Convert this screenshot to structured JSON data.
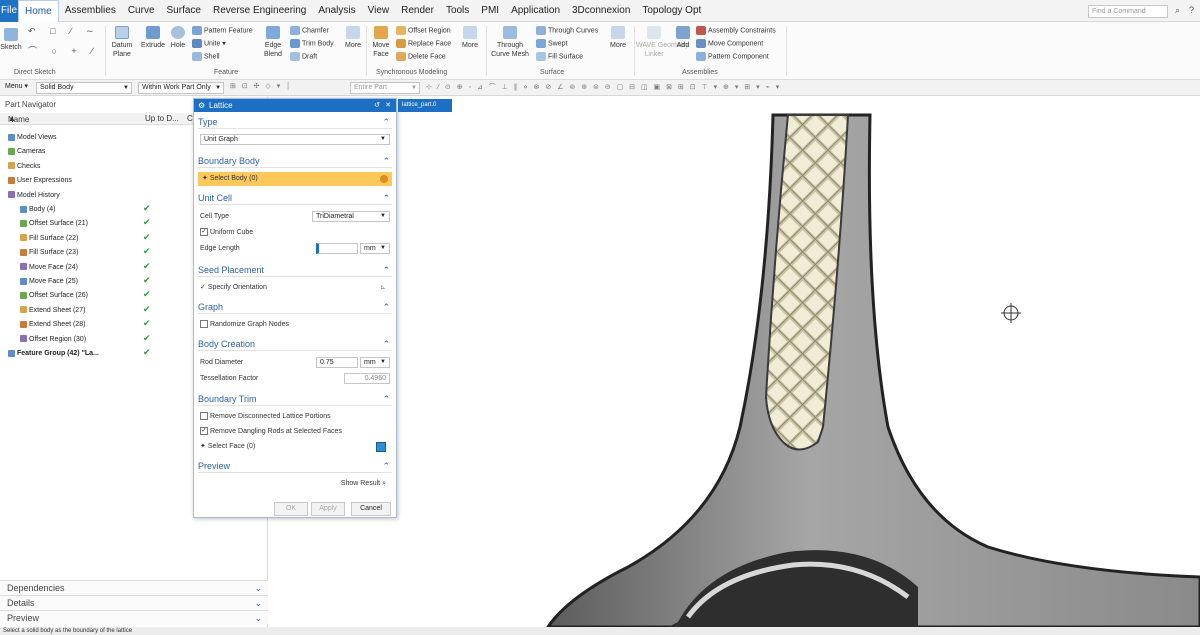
{
  "menubar": {
    "file": "File",
    "tabs": [
      "Home",
      "Assemblies",
      "Curve",
      "Surface",
      "Reverse Engineering",
      "Analysis",
      "View",
      "Render",
      "Tools",
      "PMI",
      "Application",
      "3Dconnexion",
      "Topology Opt"
    ],
    "active_tab": "Home",
    "search_placeholder": "Find a Command"
  },
  "ribbon": {
    "sketch": "Sketch",
    "datum_plane": "Datum\nPlane",
    "extrude": "Extrude",
    "hole": "Hole",
    "pattern_feature": "Pattern Feature",
    "unite": "Unite",
    "shell": "Shell",
    "edge_blend": "Edge\nBlend",
    "chamfer": "Chamfer",
    "trim_body": "Trim Body",
    "draft": "Draft",
    "more1": "More",
    "move_face": "Move\nFace",
    "offset_region": "Offset Region",
    "replace_face": "Replace Face",
    "delete_face": "Delete Face",
    "more2": "More",
    "through_curve_mesh": "Through\nCurve Mesh",
    "through_curves": "Through Curves",
    "swept": "Swept",
    "fill_surface": "Fill Surface",
    "more3": "More",
    "wave_geometry_linker": "WAVE Geometry\nLinker",
    "add": "Add",
    "assembly_constraints": "Assembly Constraints",
    "move_component": "Move Component",
    "pattern_component": "Pattern Component",
    "groups": {
      "direct_sketch": "Direct Sketch",
      "feature": "Feature",
      "synchronous_modeling": "Synchronous Modeling",
      "surface": "Surface",
      "assemblies": "Assemblies"
    }
  },
  "filterbar": {
    "menu": "Menu",
    "type_filter": "Solid Body",
    "scope": "Within Work Part Only",
    "snap": "Entire Part"
  },
  "navigator": {
    "title": "Part Navigator",
    "col_name": "Name",
    "col_up_to_date": "Up to D...",
    "col_c": "C",
    "items": [
      {
        "label": "Model Views",
        "indent": 1,
        "check": ""
      },
      {
        "label": "Cameras",
        "indent": 1,
        "check": ""
      },
      {
        "label": "Checks",
        "indent": 1,
        "check": ""
      },
      {
        "label": "User Expressions",
        "indent": 1,
        "check": ""
      },
      {
        "label": "Model History",
        "indent": 1,
        "check": ""
      },
      {
        "label": "Body (4)",
        "indent": 2,
        "check": "✔"
      },
      {
        "label": "Offset Surface (21)",
        "indent": 2,
        "check": "✔"
      },
      {
        "label": "Fill Surface (22)",
        "indent": 2,
        "check": "✔"
      },
      {
        "label": "Fill Surface (23)",
        "indent": 2,
        "check": "✔"
      },
      {
        "label": "Move Face (24)",
        "indent": 2,
        "check": "✔"
      },
      {
        "label": "Move Face (25)",
        "indent": 2,
        "check": "✔"
      },
      {
        "label": "Offset Surface (26)",
        "indent": 2,
        "check": "✔"
      },
      {
        "label": "Extend Sheet (27)",
        "indent": 2,
        "check": "✔"
      },
      {
        "label": "Extend Sheet (28)",
        "indent": 2,
        "check": "✔"
      },
      {
        "label": "Offset Region (30)",
        "indent": 2,
        "check": "✔"
      },
      {
        "label": "Feature Group (42) \"La...",
        "indent": 1,
        "check": "✔"
      }
    ],
    "bottom_panels": [
      "Dependencies",
      "Details",
      "Preview"
    ]
  },
  "dialog": {
    "title": "Lattice",
    "tab": "lattice_part.0",
    "sections": {
      "type": "Type",
      "boundary_body": "Boundary Body",
      "unit_cell": "Unit Cell",
      "seed_placement": "Seed Placement",
      "graph": "Graph",
      "body_creation": "Body Creation",
      "boundary_trim": "Boundary Trim",
      "preview": "Preview"
    },
    "type_value": "Unit Graph",
    "select_body": "Select Body (0)",
    "cell_type_label": "Cell Type",
    "cell_type_value": "TriDiametral",
    "uniform_cube": "Uniform Cube",
    "edge_length_label": "Edge Length",
    "edge_length_value": "",
    "edge_length_unit": "mm",
    "specify_orientation": "Specify Orientation",
    "randomize_graph_nodes": "Randomize Graph Nodes",
    "rod_diameter_label": "Rod Diameter",
    "rod_diameter_value": "0.75",
    "rod_diameter_unit": "mm",
    "tessellation_factor_label": "Tessellation Factor",
    "tessellation_factor_value": "0.4960",
    "remove_disconnected": "Remove Disconnected Lattice Portions",
    "remove_dangling": "Remove Dangling Rods at Selected Faces",
    "select_face": "Select Face (0)",
    "show_result": "Show Result",
    "ok": "OK",
    "apply": "Apply",
    "cancel": "Cancel"
  },
  "status": "Select a solid body as the boundary of the lattice",
  "colors": {
    "accent": "#1c6fc2",
    "selection_highlight": "#ffc85a",
    "check_green": "#2a9a3a"
  }
}
